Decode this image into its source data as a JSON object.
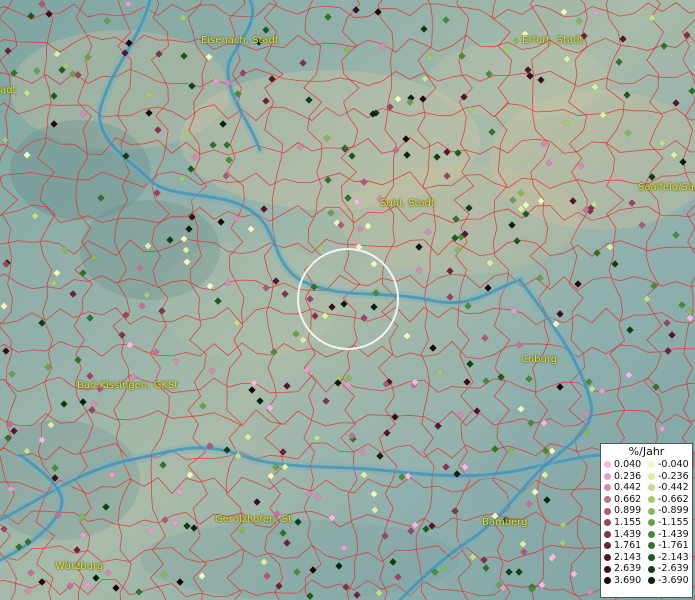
{
  "map": {
    "cities": [
      {
        "name": "Eisenach, Stadt",
        "id": "eisenach"
      },
      {
        "name": "Erfurt, Stadt",
        "id": "erfurt"
      },
      {
        "name": "Suhl, Stadt",
        "id": "suhl"
      },
      {
        "name": "Saalfeld/Sa",
        "id": "saalfeld"
      },
      {
        "name": "Bad Kissingen, GKSt",
        "id": "bad-kissingen"
      },
      {
        "name": "Coburg",
        "id": "coburg"
      },
      {
        "name": "Gerolzhofen, St",
        "id": "gerolzhofen"
      },
      {
        "name": "Bamberg",
        "id": "bamberg"
      },
      {
        "name": "Würzburg",
        "id": "wuerzburg"
      },
      {
        "name": "adt",
        "id": "edge-label"
      }
    ],
    "colors": {
      "boundary": "#e03030",
      "river": "#3d8fb0",
      "city_label": "#e8e23a",
      "selection_circle": "#f4f4f4"
    }
  },
  "legend": {
    "title": "%/Jahr",
    "positive": [
      {
        "label": "0.040",
        "color": "#f4b8e4"
      },
      {
        "label": "0.236",
        "color": "#e4a0cc"
      },
      {
        "label": "0.442",
        "color": "#d68ab4"
      },
      {
        "label": "0.662",
        "color": "#c47096"
      },
      {
        "label": "0.899",
        "color": "#b05878"
      },
      {
        "label": "1.155",
        "color": "#9a4462"
      },
      {
        "label": "1.439",
        "color": "#84324e"
      },
      {
        "label": "1.761",
        "color": "#6c223a"
      },
      {
        "label": "2.143",
        "color": "#54162a"
      },
      {
        "label": "2.639",
        "color": "#3c0c1c"
      },
      {
        "label": "3.690",
        "color": "#1e0408"
      }
    ],
    "negative": [
      {
        "label": "-0.040",
        "color": "#f2f8c0"
      },
      {
        "label": "-0.236",
        "color": "#dcefa8"
      },
      {
        "label": "-0.442",
        "color": "#c0e08c"
      },
      {
        "label": "-0.662",
        "color": "#a2cc72"
      },
      {
        "label": "-0.899",
        "color": "#84b85c"
      },
      {
        "label": "-1.155",
        "color": "#66a24a"
      },
      {
        "label": "-1.439",
        "color": "#4a8a3a"
      },
      {
        "label": "-1.761",
        "color": "#33722c"
      },
      {
        "label": "-2.143",
        "color": "#1e5a1e"
      },
      {
        "label": "-2.639",
        "color": "#0e4012"
      },
      {
        "label": "-3.690",
        "color": "#04220a"
      }
    ]
  }
}
